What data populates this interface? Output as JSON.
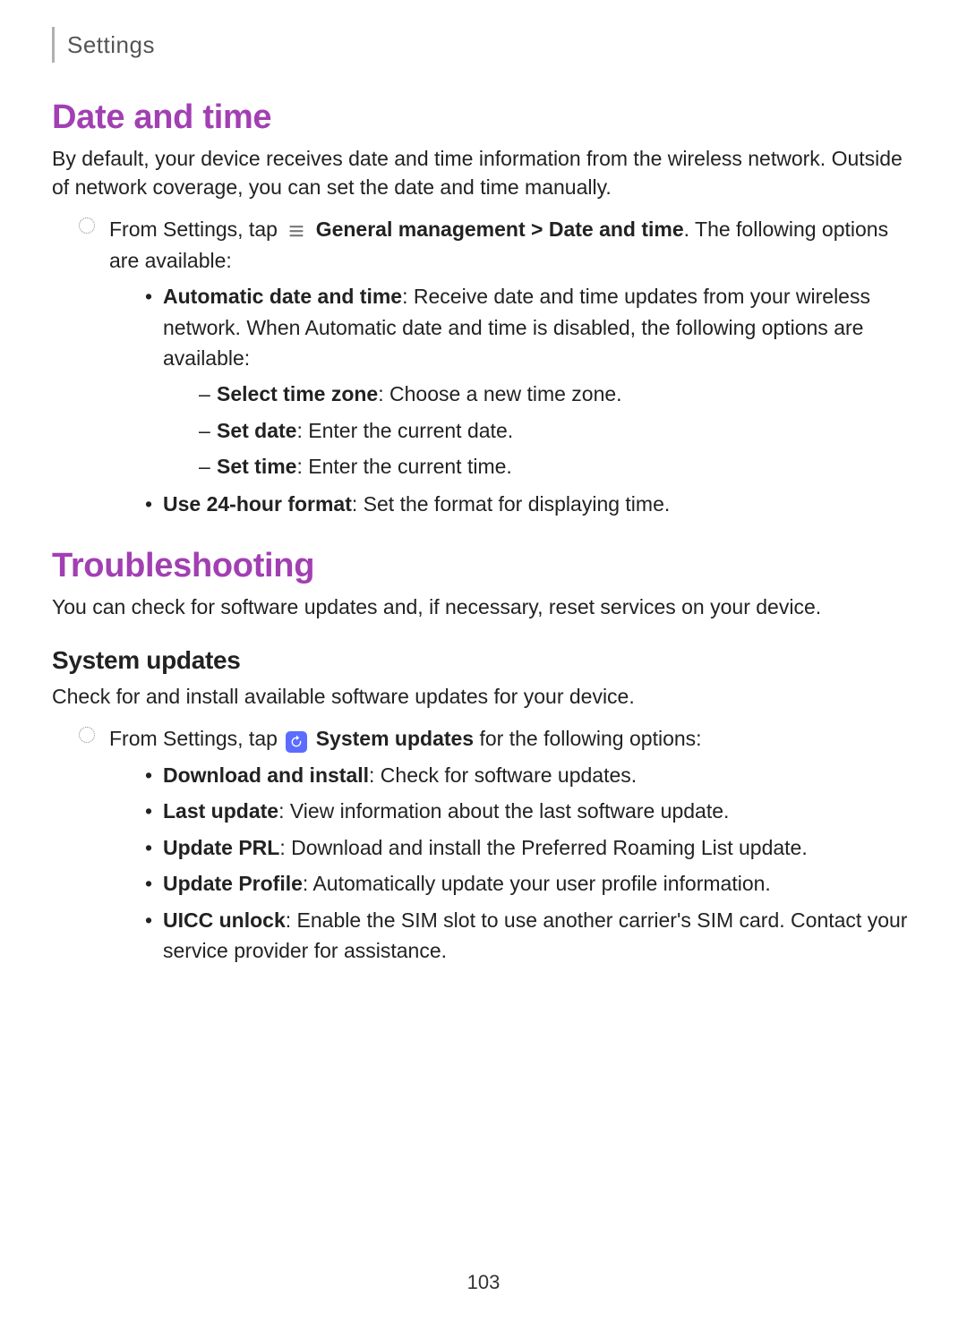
{
  "header": {
    "label": "Settings"
  },
  "section1": {
    "title": "Date and time",
    "intro": "By default, your device receives date and time information from the wireless network. Outside of network coverage, you can set the date and time manually.",
    "step_prefix": "From Settings, tap ",
    "step_bold": "General management > Date and time",
    "step_suffix": ". The following options are available:",
    "gm_icon_name": "General management",
    "bullets": [
      {
        "bold": "Automatic date and time",
        "text": ": Receive date and time updates from your wireless network. When Automatic date and time is disabled, the following options are available:"
      },
      {
        "bold": "Use 24-hour format",
        "text": ": Set the format for displaying time."
      }
    ],
    "sub_bullets": [
      {
        "bold": "Select time zone",
        "text": ": Choose a new time zone."
      },
      {
        "bold": "Set date",
        "text": ": Enter the current date."
      },
      {
        "bold": "Set time",
        "text": ": Enter the current time."
      }
    ]
  },
  "section2": {
    "title": "Troubleshooting",
    "intro": "You can check for software updates and, if necessary, reset services on your device."
  },
  "section3": {
    "title": "System updates",
    "intro": "Check for and install available software updates for your device.",
    "step_prefix": "From Settings, tap ",
    "step_bold": "System updates",
    "step_suffix": " for the following options:",
    "su_icon_name": "System updates",
    "bullets": [
      {
        "bold": "Download and install",
        "text": ": Check for software updates."
      },
      {
        "bold": "Last update",
        "text": ": View information about the last software update."
      },
      {
        "bold": "Update PRL",
        "text": ": Download and install the Preferred Roaming List update."
      },
      {
        "bold": "Update Profile",
        "text": ": Automatically update your user profile information."
      },
      {
        "bold": "UICC unlock",
        "text": ": Enable the SIM slot to use another carrier's SIM card. Contact your service provider for assistance."
      }
    ]
  },
  "page_number": "103"
}
